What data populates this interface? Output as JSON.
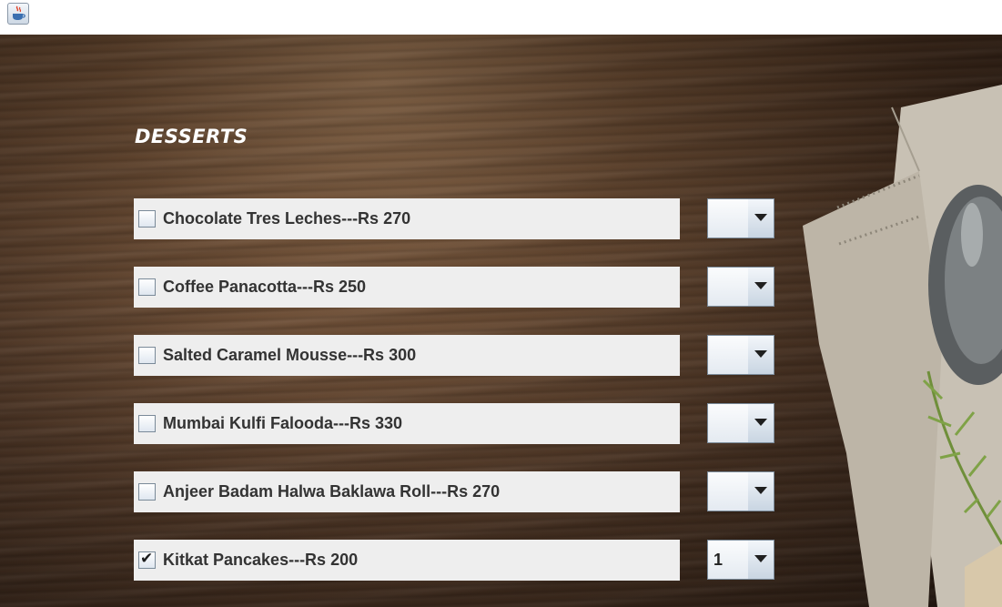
{
  "window": {
    "icon": "java-coffee-icon"
  },
  "section": {
    "title": "DESSERTS"
  },
  "items": [
    {
      "label": "Chocolate Tres Leches---Rs 270",
      "checked": false,
      "quantity": ""
    },
    {
      "label": "Coffee Panacotta---Rs 250",
      "checked": false,
      "quantity": ""
    },
    {
      "label": "Salted Caramel Mousse---Rs 300",
      "checked": false,
      "quantity": ""
    },
    {
      "label": "Mumbai Kulfi Falooda---Rs 330",
      "checked": false,
      "quantity": ""
    },
    {
      "label": "Anjeer Badam Halwa Baklawa Roll---Rs 270",
      "checked": false,
      "quantity": ""
    },
    {
      "label": "Kitkat Pancakes---Rs 200",
      "checked": true,
      "check_glyph": "✔",
      "quantity": "1"
    }
  ],
  "colors": {
    "row_bg": "#eeeeee",
    "text": "#333333",
    "heading": "#ffffff"
  }
}
